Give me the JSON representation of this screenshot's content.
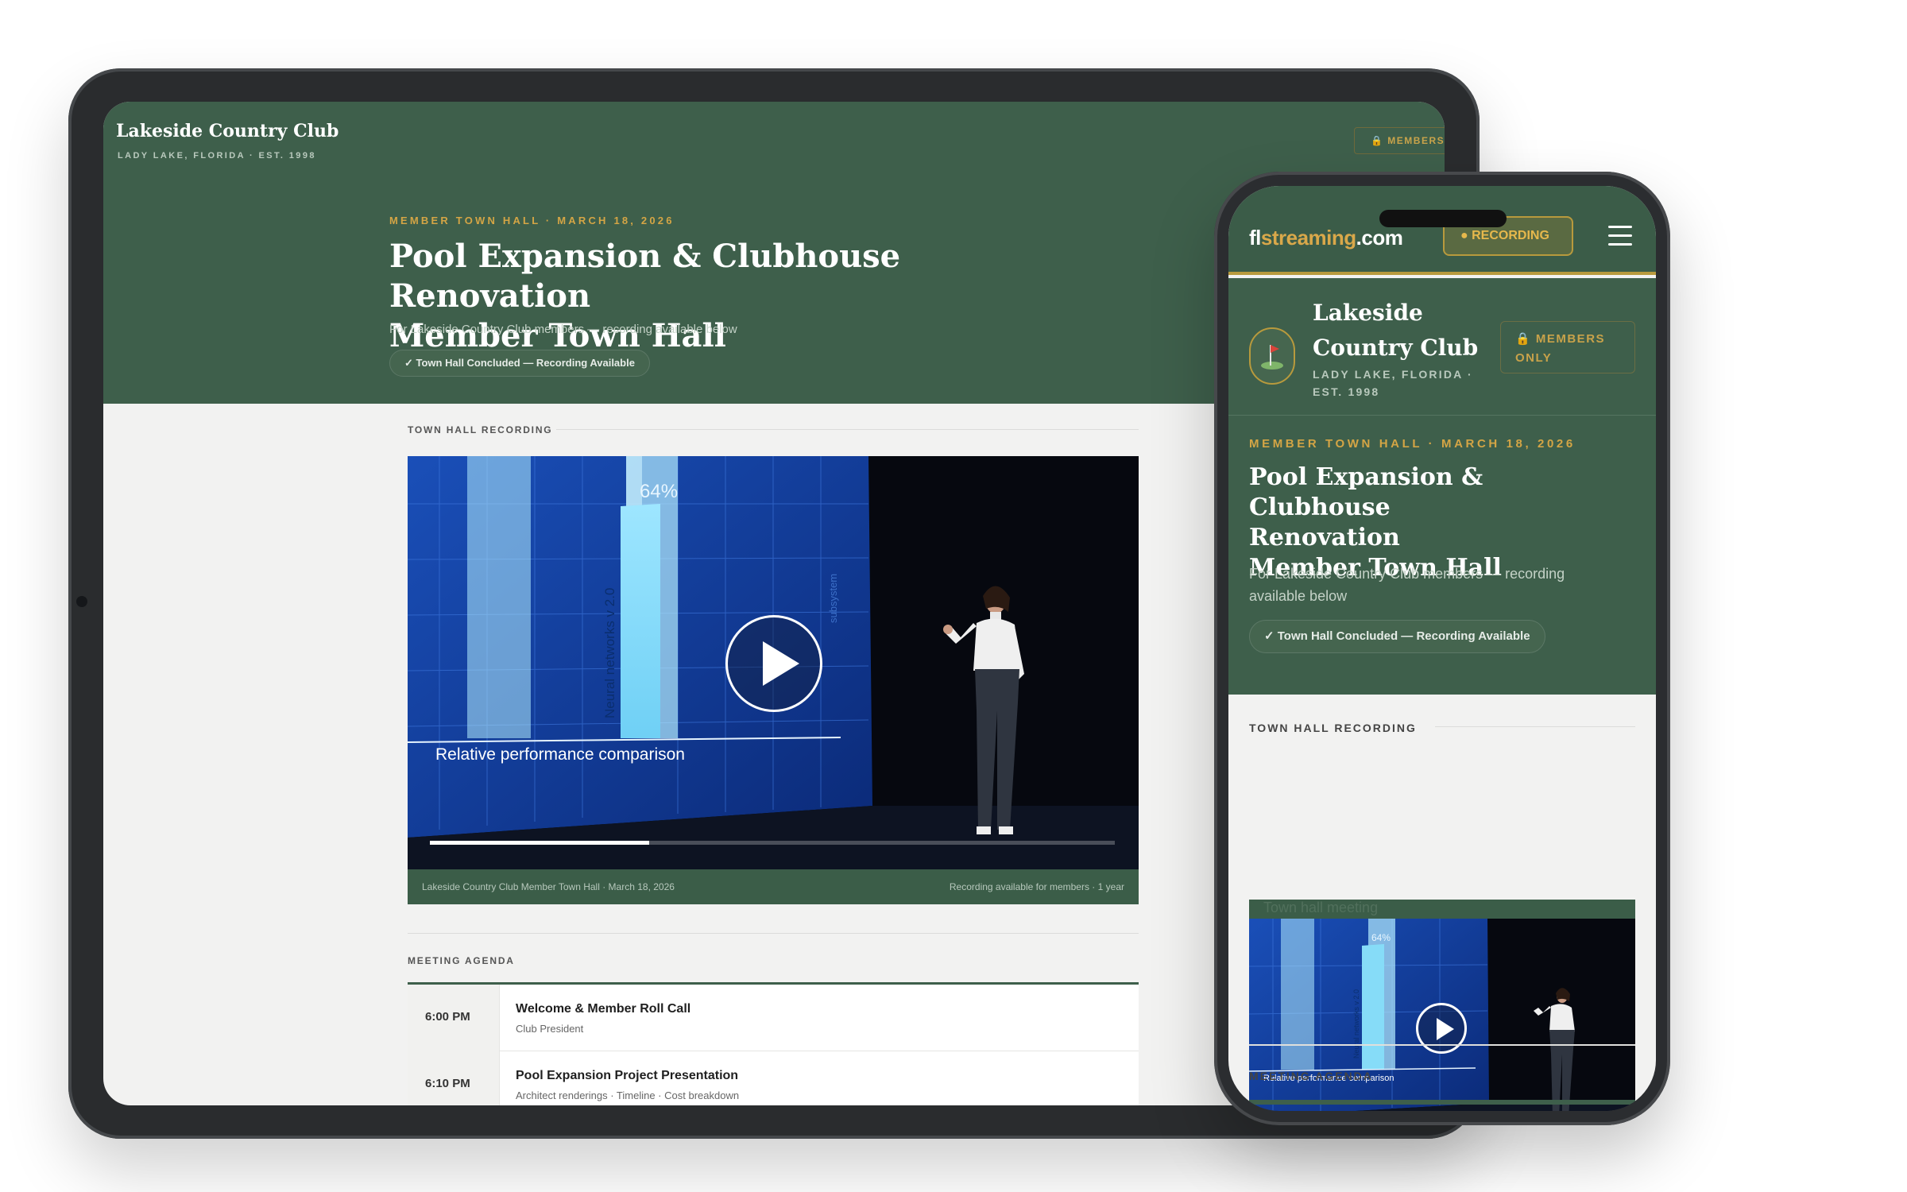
{
  "club": {
    "name": "Lakeside Country Club",
    "location": "LADY LAKE, FLORIDA · EST. 1998",
    "members_badge": "MEMBERS",
    "members_only_badge": "MEMBERS ONLY"
  },
  "event": {
    "eyebrow": "MEMBER TOWN HALL · MARCH 18, 2026",
    "title_line1": "Pool Expansion & Clubhouse Renovation",
    "title_line2": "Member Town Hall",
    "phone_title_line1": "Pool Expansion & Clubhouse",
    "phone_title_line2": "Renovation",
    "subtitle": "For Lakeside Country Club members — recording available below",
    "status_pill": "✓ Town Hall Concluded — Recording Available"
  },
  "recording": {
    "section_label": "TOWN HALL RECORDING",
    "caption_left": "Lakeside Country Club Member Town Hall · March 18, 2026",
    "caption_right": "Recording available for members · 1 year",
    "image_alt": "Town hall meeting",
    "progress_fraction": 0.32,
    "slide_title": "Relative performance comparison",
    "slide_axis": "Neural networks v 2.0",
    "slide_value": "64%",
    "slide_side": "subsystem"
  },
  "agenda": {
    "section_label": "MEETING AGENDA",
    "items": [
      {
        "time": "6:00 PM",
        "title": "Welcome & Member Roll Call",
        "detail": "Club President"
      },
      {
        "time": "6:10 PM",
        "title": "Pool Expansion Project Presentation",
        "detail": "Architect renderings · Timeline · Cost breakdown"
      }
    ]
  },
  "phone_nav": {
    "logo_prefix": "fl",
    "logo_middle": "streaming",
    "logo_suffix": ".com",
    "recording_badge": "● RECORDING",
    "menu_icon": "hamburger-icon"
  },
  "colors": {
    "hero_green": "#3e5f4b",
    "accent_gold": "#d4a545",
    "pill_green": "#45654f"
  }
}
